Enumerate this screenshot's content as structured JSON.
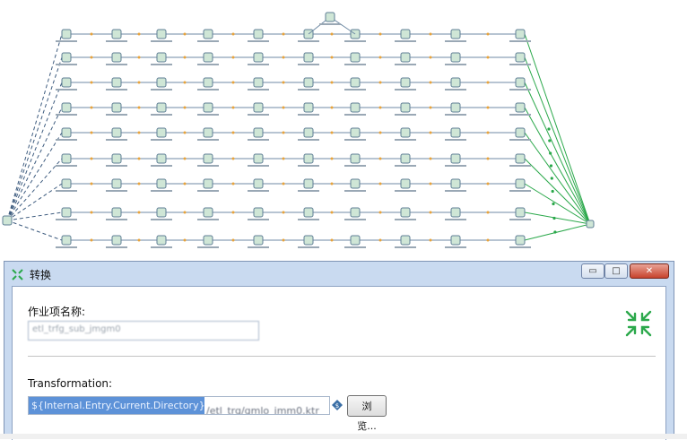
{
  "dialog": {
    "title": "转换",
    "title_icon": "kettle-job-icon",
    "window_controls": {
      "minimize": "▭",
      "maximize": "□",
      "close": "✕"
    },
    "job_entry_name_label": "作业项名称:",
    "job_entry_name_value": "etl_trfg_sub_jmgm0",
    "transformation_label": "Transformation:",
    "transformation_path_selected": "${Internal.Entry.Current.Directory}",
    "transformation_path_rest": "/etl_trg/gmlo_jmm0.ktr",
    "browse_label": "浏览...",
    "collapse_icon": "shrink-arrows-icon",
    "accent_color": "#2aa84a"
  },
  "canvas": {
    "description_icon": "job-flow-graph",
    "hop_colors": {
      "normal": "#6f8aa4",
      "success": "#2aa84a",
      "unconditional": "#3e5c7f"
    }
  }
}
